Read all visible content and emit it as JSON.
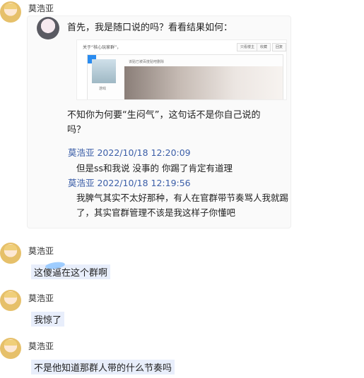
{
  "top_message": {
    "sender": "莫浩亚",
    "text1": "首先，我是随口说的吗？看看结果如何：",
    "screenshot": {
      "title": "关于“核心玩家群”，",
      "buttons": [
        "只看楼主",
        "收藏",
        "回复"
      ],
      "note": "该贴已被百度贴吧删除",
      "tag": "游戏"
    },
    "text2_line1": "不知你为何要“生闷气”，这句话不是你自己说的",
    "text2_line2": "吗？",
    "quotes": [
      {
        "header": "莫浩亚  2022/10/18 12:20:09",
        "lines": [
          "但是ss和我说 没事的 你踢了肯定有道理"
        ]
      },
      {
        "header": "莫浩亚  2022/10/18 12:19:56",
        "lines": [
          "我脾气其实不太好那种，有人在官群带节奏骂人我就踢",
          "了，其实官群管理不该是我这样子你懂吧"
        ]
      }
    ]
  },
  "messages": [
    {
      "sender": "莫浩亚",
      "text": "这傻逼在这个群啊"
    },
    {
      "sender": "莫浩亚",
      "text": "我惊了"
    },
    {
      "sender": "莫浩亚",
      "text": "不是他知道那群人带的什么节奏吗"
    }
  ]
}
